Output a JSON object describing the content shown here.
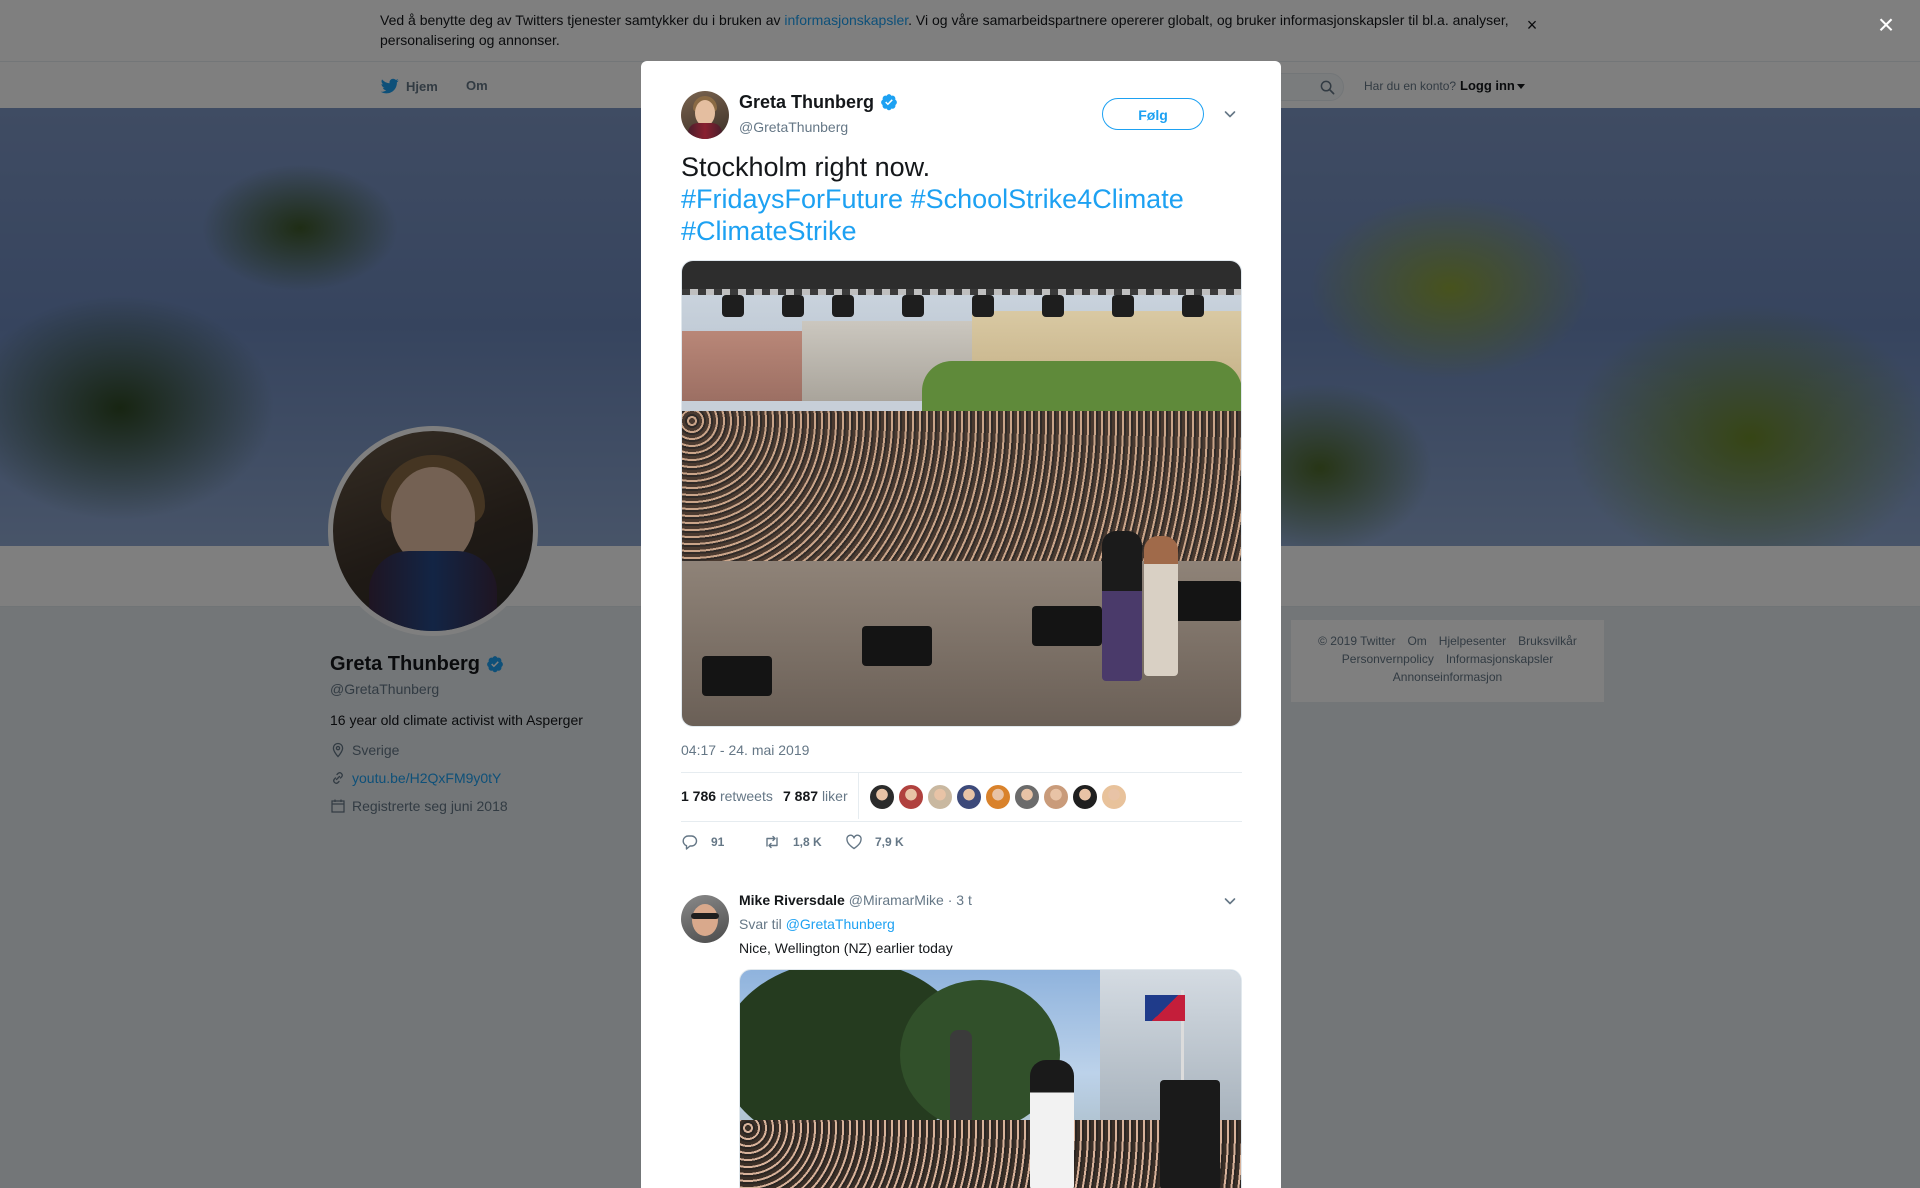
{
  "cookie_banner": {
    "text_before": "Ved å benytte deg av Twitters tjenester samtykker du i bruken av ",
    "link": "informasjonskapsler",
    "text_after": ". Vi og våre samarbeidspartnere opererer globalt, og bruker informasjonskapsler til bl.a. analyser, personalisering og annonser.",
    "close": "×"
  },
  "nav": {
    "home": "Hjem",
    "about": "Om",
    "account_prompt": "Har du en konto?",
    "login": "Logg inn"
  },
  "profile": {
    "name": "Greta Thunberg",
    "handle": "@GretaThunberg",
    "bio": "16 year old climate activist with Asperger",
    "location": "Sverige",
    "url": "youtu.be/H2QxFM9y0tY",
    "joined": "Registrerte seg juni 2018"
  },
  "footer": {
    "row1": [
      "© 2019 Twitter",
      "Om",
      "Hjelpesenter",
      "Bruksvilkår"
    ],
    "row2": [
      "Personvernpolicy",
      "Informasjonskapsler"
    ],
    "row3": [
      "Annonseinformasjon"
    ]
  },
  "overlay": {
    "close": "×"
  },
  "tweet": {
    "author_name": "Greta Thunberg",
    "author_handle": "@GretaThunberg",
    "follow_label": "Følg",
    "text": "Stockholm right now.",
    "hashtags": [
      "#FridaysForFuture",
      "#SchoolStrike4Climate",
      "#ClimateStrike"
    ],
    "timestamp": "04:17 - 24. mai 2019",
    "retweets_count": "1 786",
    "retweets_label": "retweets",
    "likes_count": "7 887",
    "likes_label": "liker",
    "liker_colors": [
      "#2b2b2b",
      "#b0413e",
      "#c9b8a0",
      "#3d4a7a",
      "#d9822b",
      "#6b6b6b",
      "#c99b7a",
      "#1f1f1f",
      "#e8c29b"
    ],
    "reply_count": "91",
    "retweet_count_short": "1,8 K",
    "like_count_short": "7,9 K"
  },
  "reply": {
    "name": "Mike Riversdale",
    "handle": "@MiramarMike",
    "time": "· 3 t",
    "reply_to_label": "Svar til",
    "reply_to_handle": "@GretaThunberg",
    "text": "Nice, Wellington (NZ) earlier today"
  },
  "colors": {
    "accent": "#1da1f2",
    "text": "#14171a",
    "secondary": "#657786"
  }
}
